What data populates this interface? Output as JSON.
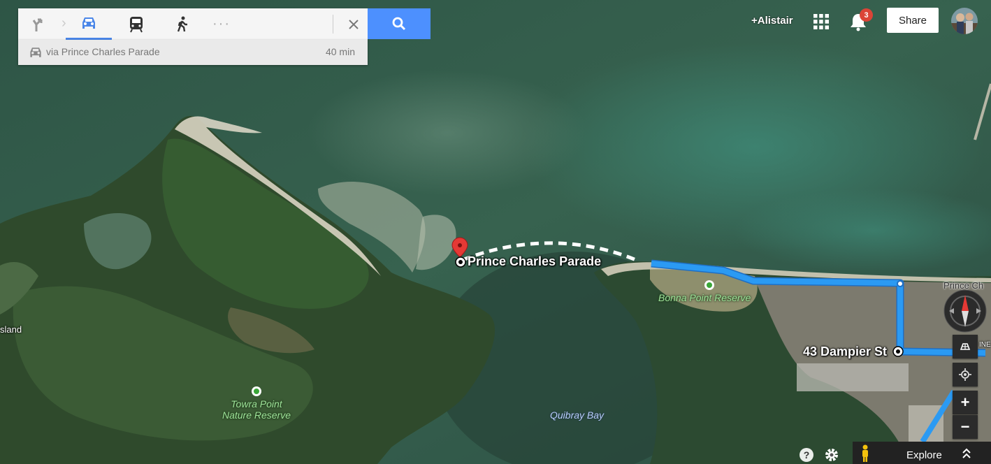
{
  "directions": {
    "modes": [
      {
        "name": "route-options",
        "icon": "turn-icon"
      },
      {
        "name": "driving",
        "icon": "car-icon",
        "active": true
      },
      {
        "name": "transit",
        "icon": "train-icon"
      },
      {
        "name": "walking",
        "icon": "walk-icon"
      },
      {
        "name": "more",
        "icon": "more-icon"
      }
    ],
    "route_via": "via Prince Charles Parade",
    "route_time": "40 min"
  },
  "header": {
    "user": "+Alistair",
    "notifications": "3",
    "share_label": "Share"
  },
  "map": {
    "place_destination": "Prince Charles Parade",
    "place_origin": "43 Dampier St",
    "park_1_line1": "Towra Point",
    "park_1_line2": "Nature Reserve",
    "park_2": "Bonna Point Reserve",
    "water_bay": "Quibray Bay",
    "edge_label_left": "sland",
    "edge_label_road": "Prince Ch",
    "edge_label_small": "INE"
  },
  "controls": {
    "explore_label": "Explore",
    "zoom_in": "+",
    "zoom_out": "−"
  },
  "colors": {
    "route": "#2b9af3",
    "search": "#4d90fe",
    "badge": "#db4437"
  }
}
